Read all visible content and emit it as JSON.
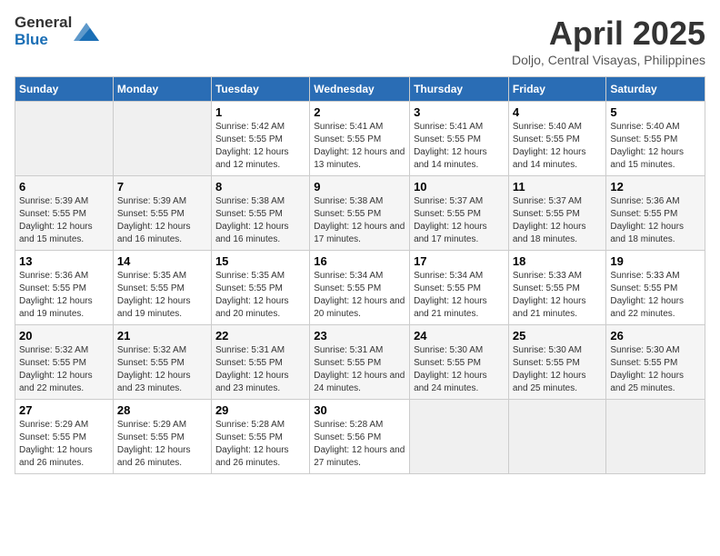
{
  "logo": {
    "general": "General",
    "blue": "Blue"
  },
  "title": "April 2025",
  "subtitle": "Doljo, Central Visayas, Philippines",
  "days_header": [
    "Sunday",
    "Monday",
    "Tuesday",
    "Wednesday",
    "Thursday",
    "Friday",
    "Saturday"
  ],
  "weeks": [
    [
      {
        "day": "",
        "sunrise": "",
        "sunset": "",
        "daylight": ""
      },
      {
        "day": "",
        "sunrise": "",
        "sunset": "",
        "daylight": ""
      },
      {
        "day": "1",
        "sunrise": "Sunrise: 5:42 AM",
        "sunset": "Sunset: 5:55 PM",
        "daylight": "Daylight: 12 hours and 12 minutes."
      },
      {
        "day": "2",
        "sunrise": "Sunrise: 5:41 AM",
        "sunset": "Sunset: 5:55 PM",
        "daylight": "Daylight: 12 hours and 13 minutes."
      },
      {
        "day": "3",
        "sunrise": "Sunrise: 5:41 AM",
        "sunset": "Sunset: 5:55 PM",
        "daylight": "Daylight: 12 hours and 14 minutes."
      },
      {
        "day": "4",
        "sunrise": "Sunrise: 5:40 AM",
        "sunset": "Sunset: 5:55 PM",
        "daylight": "Daylight: 12 hours and 14 minutes."
      },
      {
        "day": "5",
        "sunrise": "Sunrise: 5:40 AM",
        "sunset": "Sunset: 5:55 PM",
        "daylight": "Daylight: 12 hours and 15 minutes."
      }
    ],
    [
      {
        "day": "6",
        "sunrise": "Sunrise: 5:39 AM",
        "sunset": "Sunset: 5:55 PM",
        "daylight": "Daylight: 12 hours and 15 minutes."
      },
      {
        "day": "7",
        "sunrise": "Sunrise: 5:39 AM",
        "sunset": "Sunset: 5:55 PM",
        "daylight": "Daylight: 12 hours and 16 minutes."
      },
      {
        "day": "8",
        "sunrise": "Sunrise: 5:38 AM",
        "sunset": "Sunset: 5:55 PM",
        "daylight": "Daylight: 12 hours and 16 minutes."
      },
      {
        "day": "9",
        "sunrise": "Sunrise: 5:38 AM",
        "sunset": "Sunset: 5:55 PM",
        "daylight": "Daylight: 12 hours and 17 minutes."
      },
      {
        "day": "10",
        "sunrise": "Sunrise: 5:37 AM",
        "sunset": "Sunset: 5:55 PM",
        "daylight": "Daylight: 12 hours and 17 minutes."
      },
      {
        "day": "11",
        "sunrise": "Sunrise: 5:37 AM",
        "sunset": "Sunset: 5:55 PM",
        "daylight": "Daylight: 12 hours and 18 minutes."
      },
      {
        "day": "12",
        "sunrise": "Sunrise: 5:36 AM",
        "sunset": "Sunset: 5:55 PM",
        "daylight": "Daylight: 12 hours and 18 minutes."
      }
    ],
    [
      {
        "day": "13",
        "sunrise": "Sunrise: 5:36 AM",
        "sunset": "Sunset: 5:55 PM",
        "daylight": "Daylight: 12 hours and 19 minutes."
      },
      {
        "day": "14",
        "sunrise": "Sunrise: 5:35 AM",
        "sunset": "Sunset: 5:55 PM",
        "daylight": "Daylight: 12 hours and 19 minutes."
      },
      {
        "day": "15",
        "sunrise": "Sunrise: 5:35 AM",
        "sunset": "Sunset: 5:55 PM",
        "daylight": "Daylight: 12 hours and 20 minutes."
      },
      {
        "day": "16",
        "sunrise": "Sunrise: 5:34 AM",
        "sunset": "Sunset: 5:55 PM",
        "daylight": "Daylight: 12 hours and 20 minutes."
      },
      {
        "day": "17",
        "sunrise": "Sunrise: 5:34 AM",
        "sunset": "Sunset: 5:55 PM",
        "daylight": "Daylight: 12 hours and 21 minutes."
      },
      {
        "day": "18",
        "sunrise": "Sunrise: 5:33 AM",
        "sunset": "Sunset: 5:55 PM",
        "daylight": "Daylight: 12 hours and 21 minutes."
      },
      {
        "day": "19",
        "sunrise": "Sunrise: 5:33 AM",
        "sunset": "Sunset: 5:55 PM",
        "daylight": "Daylight: 12 hours and 22 minutes."
      }
    ],
    [
      {
        "day": "20",
        "sunrise": "Sunrise: 5:32 AM",
        "sunset": "Sunset: 5:55 PM",
        "daylight": "Daylight: 12 hours and 22 minutes."
      },
      {
        "day": "21",
        "sunrise": "Sunrise: 5:32 AM",
        "sunset": "Sunset: 5:55 PM",
        "daylight": "Daylight: 12 hours and 23 minutes."
      },
      {
        "day": "22",
        "sunrise": "Sunrise: 5:31 AM",
        "sunset": "Sunset: 5:55 PM",
        "daylight": "Daylight: 12 hours and 23 minutes."
      },
      {
        "day": "23",
        "sunrise": "Sunrise: 5:31 AM",
        "sunset": "Sunset: 5:55 PM",
        "daylight": "Daylight: 12 hours and 24 minutes."
      },
      {
        "day": "24",
        "sunrise": "Sunrise: 5:30 AM",
        "sunset": "Sunset: 5:55 PM",
        "daylight": "Daylight: 12 hours and 24 minutes."
      },
      {
        "day": "25",
        "sunrise": "Sunrise: 5:30 AM",
        "sunset": "Sunset: 5:55 PM",
        "daylight": "Daylight: 12 hours and 25 minutes."
      },
      {
        "day": "26",
        "sunrise": "Sunrise: 5:30 AM",
        "sunset": "Sunset: 5:55 PM",
        "daylight": "Daylight: 12 hours and 25 minutes."
      }
    ],
    [
      {
        "day": "27",
        "sunrise": "Sunrise: 5:29 AM",
        "sunset": "Sunset: 5:55 PM",
        "daylight": "Daylight: 12 hours and 26 minutes."
      },
      {
        "day": "28",
        "sunrise": "Sunrise: 5:29 AM",
        "sunset": "Sunset: 5:55 PM",
        "daylight": "Daylight: 12 hours and 26 minutes."
      },
      {
        "day": "29",
        "sunrise": "Sunrise: 5:28 AM",
        "sunset": "Sunset: 5:55 PM",
        "daylight": "Daylight: 12 hours and 26 minutes."
      },
      {
        "day": "30",
        "sunrise": "Sunrise: 5:28 AM",
        "sunset": "Sunset: 5:56 PM",
        "daylight": "Daylight: 12 hours and 27 minutes."
      },
      {
        "day": "",
        "sunrise": "",
        "sunset": "",
        "daylight": ""
      },
      {
        "day": "",
        "sunrise": "",
        "sunset": "",
        "daylight": ""
      },
      {
        "day": "",
        "sunrise": "",
        "sunset": "",
        "daylight": ""
      }
    ]
  ]
}
